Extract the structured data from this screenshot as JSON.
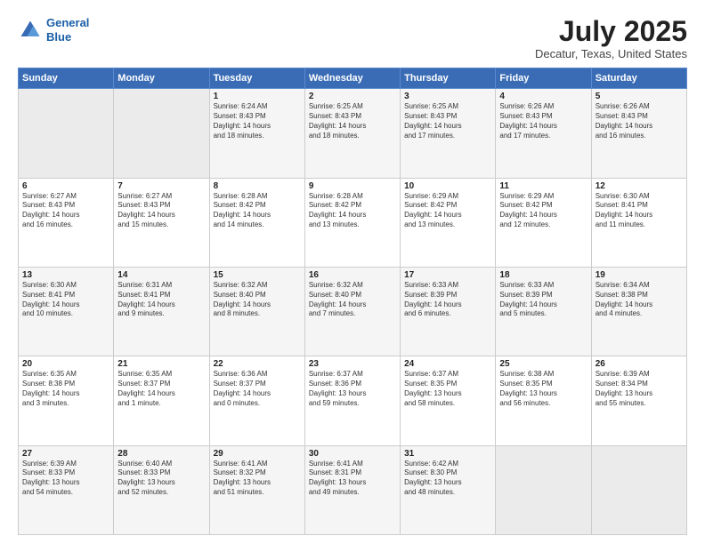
{
  "header": {
    "logo_line1": "General",
    "logo_line2": "Blue",
    "title": "July 2025",
    "subtitle": "Decatur, Texas, United States"
  },
  "weekdays": [
    "Sunday",
    "Monday",
    "Tuesday",
    "Wednesday",
    "Thursday",
    "Friday",
    "Saturday"
  ],
  "weeks": [
    [
      {
        "day": "",
        "detail": ""
      },
      {
        "day": "",
        "detail": ""
      },
      {
        "day": "1",
        "detail": "Sunrise: 6:24 AM\nSunset: 8:43 PM\nDaylight: 14 hours\nand 18 minutes."
      },
      {
        "day": "2",
        "detail": "Sunrise: 6:25 AM\nSunset: 8:43 PM\nDaylight: 14 hours\nand 18 minutes."
      },
      {
        "day": "3",
        "detail": "Sunrise: 6:25 AM\nSunset: 8:43 PM\nDaylight: 14 hours\nand 17 minutes."
      },
      {
        "day": "4",
        "detail": "Sunrise: 6:26 AM\nSunset: 8:43 PM\nDaylight: 14 hours\nand 17 minutes."
      },
      {
        "day": "5",
        "detail": "Sunrise: 6:26 AM\nSunset: 8:43 PM\nDaylight: 14 hours\nand 16 minutes."
      }
    ],
    [
      {
        "day": "6",
        "detail": "Sunrise: 6:27 AM\nSunset: 8:43 PM\nDaylight: 14 hours\nand 16 minutes."
      },
      {
        "day": "7",
        "detail": "Sunrise: 6:27 AM\nSunset: 8:43 PM\nDaylight: 14 hours\nand 15 minutes."
      },
      {
        "day": "8",
        "detail": "Sunrise: 6:28 AM\nSunset: 8:42 PM\nDaylight: 14 hours\nand 14 minutes."
      },
      {
        "day": "9",
        "detail": "Sunrise: 6:28 AM\nSunset: 8:42 PM\nDaylight: 14 hours\nand 13 minutes."
      },
      {
        "day": "10",
        "detail": "Sunrise: 6:29 AM\nSunset: 8:42 PM\nDaylight: 14 hours\nand 13 minutes."
      },
      {
        "day": "11",
        "detail": "Sunrise: 6:29 AM\nSunset: 8:42 PM\nDaylight: 14 hours\nand 12 minutes."
      },
      {
        "day": "12",
        "detail": "Sunrise: 6:30 AM\nSunset: 8:41 PM\nDaylight: 14 hours\nand 11 minutes."
      }
    ],
    [
      {
        "day": "13",
        "detail": "Sunrise: 6:30 AM\nSunset: 8:41 PM\nDaylight: 14 hours\nand 10 minutes."
      },
      {
        "day": "14",
        "detail": "Sunrise: 6:31 AM\nSunset: 8:41 PM\nDaylight: 14 hours\nand 9 minutes."
      },
      {
        "day": "15",
        "detail": "Sunrise: 6:32 AM\nSunset: 8:40 PM\nDaylight: 14 hours\nand 8 minutes."
      },
      {
        "day": "16",
        "detail": "Sunrise: 6:32 AM\nSunset: 8:40 PM\nDaylight: 14 hours\nand 7 minutes."
      },
      {
        "day": "17",
        "detail": "Sunrise: 6:33 AM\nSunset: 8:39 PM\nDaylight: 14 hours\nand 6 minutes."
      },
      {
        "day": "18",
        "detail": "Sunrise: 6:33 AM\nSunset: 8:39 PM\nDaylight: 14 hours\nand 5 minutes."
      },
      {
        "day": "19",
        "detail": "Sunrise: 6:34 AM\nSunset: 8:38 PM\nDaylight: 14 hours\nand 4 minutes."
      }
    ],
    [
      {
        "day": "20",
        "detail": "Sunrise: 6:35 AM\nSunset: 8:38 PM\nDaylight: 14 hours\nand 3 minutes."
      },
      {
        "day": "21",
        "detail": "Sunrise: 6:35 AM\nSunset: 8:37 PM\nDaylight: 14 hours\nand 1 minute."
      },
      {
        "day": "22",
        "detail": "Sunrise: 6:36 AM\nSunset: 8:37 PM\nDaylight: 14 hours\nand 0 minutes."
      },
      {
        "day": "23",
        "detail": "Sunrise: 6:37 AM\nSunset: 8:36 PM\nDaylight: 13 hours\nand 59 minutes."
      },
      {
        "day": "24",
        "detail": "Sunrise: 6:37 AM\nSunset: 8:35 PM\nDaylight: 13 hours\nand 58 minutes."
      },
      {
        "day": "25",
        "detail": "Sunrise: 6:38 AM\nSunset: 8:35 PM\nDaylight: 13 hours\nand 56 minutes."
      },
      {
        "day": "26",
        "detail": "Sunrise: 6:39 AM\nSunset: 8:34 PM\nDaylight: 13 hours\nand 55 minutes."
      }
    ],
    [
      {
        "day": "27",
        "detail": "Sunrise: 6:39 AM\nSunset: 8:33 PM\nDaylight: 13 hours\nand 54 minutes."
      },
      {
        "day": "28",
        "detail": "Sunrise: 6:40 AM\nSunset: 8:33 PM\nDaylight: 13 hours\nand 52 minutes."
      },
      {
        "day": "29",
        "detail": "Sunrise: 6:41 AM\nSunset: 8:32 PM\nDaylight: 13 hours\nand 51 minutes."
      },
      {
        "day": "30",
        "detail": "Sunrise: 6:41 AM\nSunset: 8:31 PM\nDaylight: 13 hours\nand 49 minutes."
      },
      {
        "day": "31",
        "detail": "Sunrise: 6:42 AM\nSunset: 8:30 PM\nDaylight: 13 hours\nand 48 minutes."
      },
      {
        "day": "",
        "detail": ""
      },
      {
        "day": "",
        "detail": ""
      }
    ]
  ]
}
